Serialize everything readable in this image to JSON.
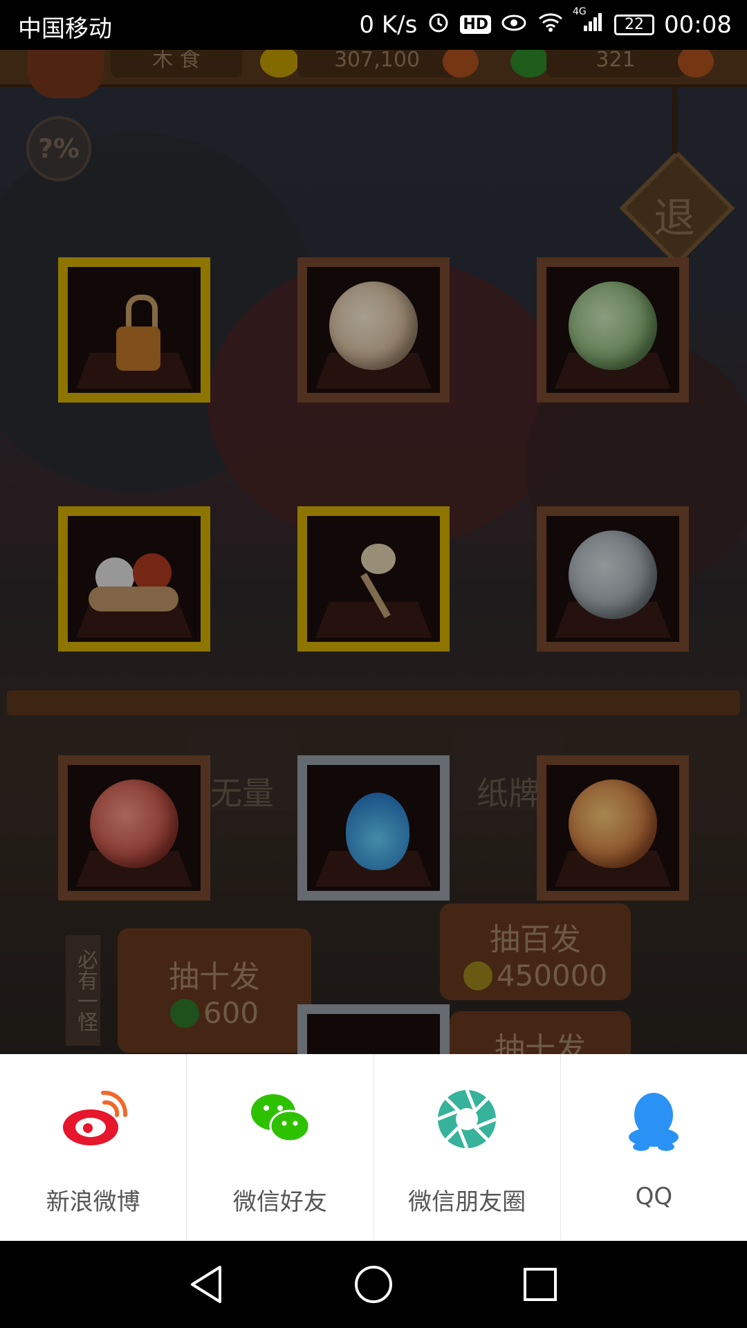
{
  "status_bar": {
    "carrier": "中国移动",
    "net_speed": "0 K/s",
    "hd_badge": "HD",
    "signal_4g": "4G",
    "battery": "22",
    "time": "00:08"
  },
  "game": {
    "top_left_text": "木 食",
    "coins_text": "307,100",
    "gems_text": "321",
    "exit_label": "退",
    "help_label": "?%",
    "bottom_tabs": [
      "无量",
      "纸牌"
    ],
    "side_tag": "必有一怪",
    "draw_hundred": {
      "label": "抽百发",
      "cost": "450000"
    },
    "draw_ten": {
      "label": "抽十发",
      "cost": "600"
    },
    "draw_ten_2": {
      "label": "抽十发"
    },
    "item_frames": [
      "gold",
      "bronze",
      "bronze",
      "gold",
      "gold",
      "bronze",
      "bronze",
      "silver",
      "bronze"
    ]
  },
  "share": {
    "items": [
      {
        "label": "新浪微博",
        "icon": "weibo-icon",
        "color": "#e6162d"
      },
      {
        "label": "微信好友",
        "icon": "wechat-icon",
        "color": "#2dc100"
      },
      {
        "label": "微信朋友圈",
        "icon": "wechat-moments-icon",
        "color": "#36b39a"
      },
      {
        "label": "QQ",
        "icon": "qq-icon",
        "color": "#2b92f5"
      }
    ]
  }
}
